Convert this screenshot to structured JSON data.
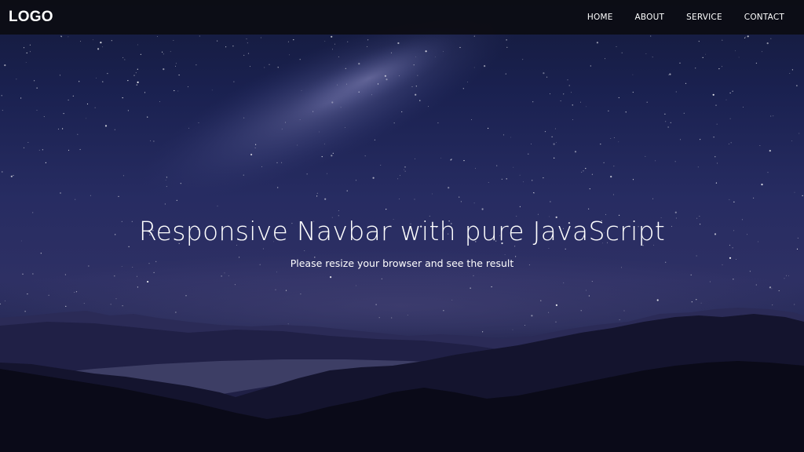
{
  "navbar": {
    "logo": "LOGO",
    "links": [
      {
        "label": "HOME"
      },
      {
        "label": "ABOUT"
      },
      {
        "label": "SERVICE"
      },
      {
        "label": "CONTACT"
      }
    ]
  },
  "hero": {
    "title": "Responsive Navbar with pure JavaScript",
    "subtitle": "Please resize your browser and see the result",
    "background_image": "starry-night-sky-over-mountains"
  },
  "colors": {
    "sky_top": "#141a3b",
    "sky_mid": "#272c62",
    "mountain_far": "#2a2b55",
    "mountain_near": "#0b0b1c",
    "navbar_bg": "#0c0c12",
    "text": "#ffffff"
  }
}
